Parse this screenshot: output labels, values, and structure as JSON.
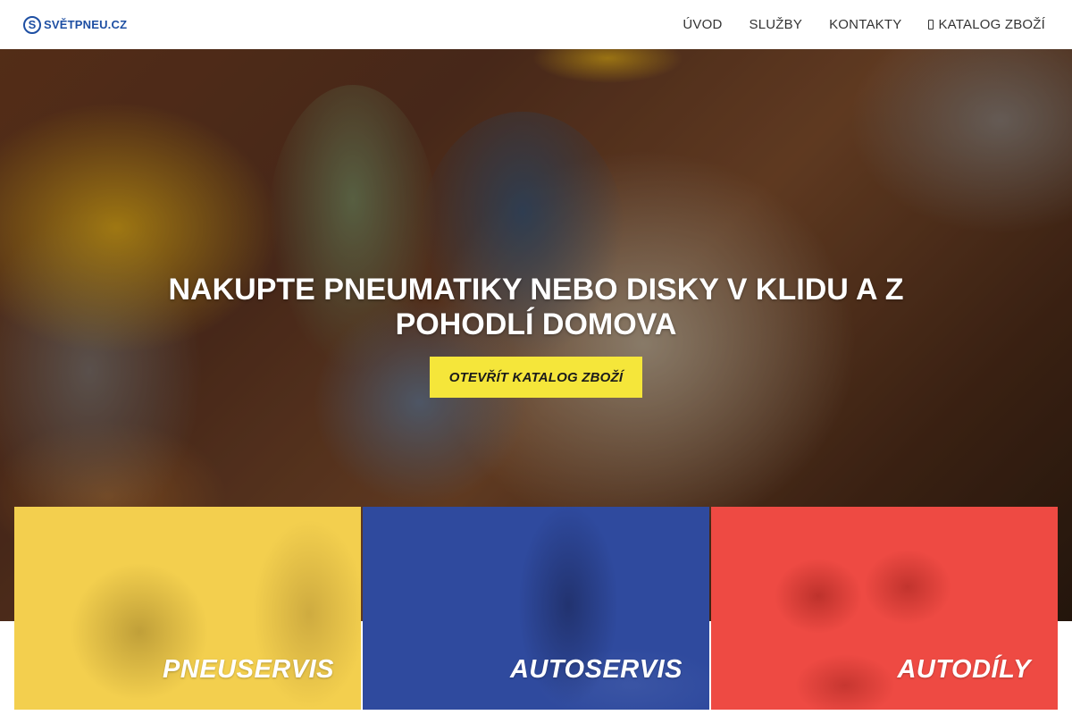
{
  "header": {
    "logo_mark": "S",
    "logo_text": "SVĚTPNEU.CZ",
    "nav": [
      {
        "label": "ÚVOD"
      },
      {
        "label": "SLUŽBY"
      },
      {
        "label": "KONTAKTY"
      },
      {
        "label": "KATALOG ZBOŽÍ",
        "icon": "cart-icon"
      }
    ]
  },
  "hero": {
    "title_line1": "NAKUPTE PNEUMATIKY NEBO DISKY V KLIDU A Z",
    "title_line2": "POHODLÍ DOMOVA",
    "cta_label": "OTEVŘÍT KATALOG ZBOŽÍ"
  },
  "cards": [
    {
      "label": "PNEUSERVIS",
      "color": "#f3cf4e"
    },
    {
      "label": "AUTOSERVIS",
      "color": "#2f4a9e"
    },
    {
      "label": "AUTODÍLY",
      "color": "#ee4a43"
    }
  ],
  "colors": {
    "brand": "#1e4fa3",
    "cta": "#f5e63a"
  }
}
